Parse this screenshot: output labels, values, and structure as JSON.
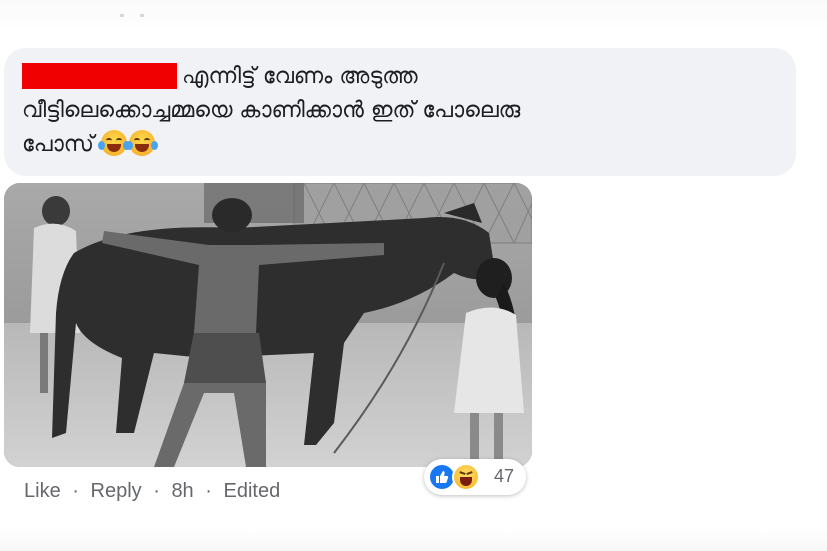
{
  "comment": {
    "author_redacted": true,
    "text_line1": "എന്നിട്ട് വേണം അടുത്ത",
    "text_line2": "വീട്ടിലെക്കൊച്ചമ്മയെ കാണിക്കാൻ ഇത് പോലെരു",
    "text_line3": "പോസ്",
    "emojis": [
      "laughing-with-tears-emoji",
      "laughing-with-tears-emoji"
    ]
  },
  "attachment": {
    "type": "photo",
    "style": "black-and-white"
  },
  "actions": {
    "like_label": "Like",
    "separator": "·",
    "reply_label": "Reply",
    "time": "8h",
    "edited_label": "Edited"
  },
  "reactions": {
    "icons": [
      "like-icon",
      "haha-icon"
    ],
    "count": "47"
  },
  "colors": {
    "bubble_bg": "#f0f2f5",
    "redaction": "#f00000",
    "meta_text": "#65676b",
    "like_blue": "#1877f2"
  }
}
